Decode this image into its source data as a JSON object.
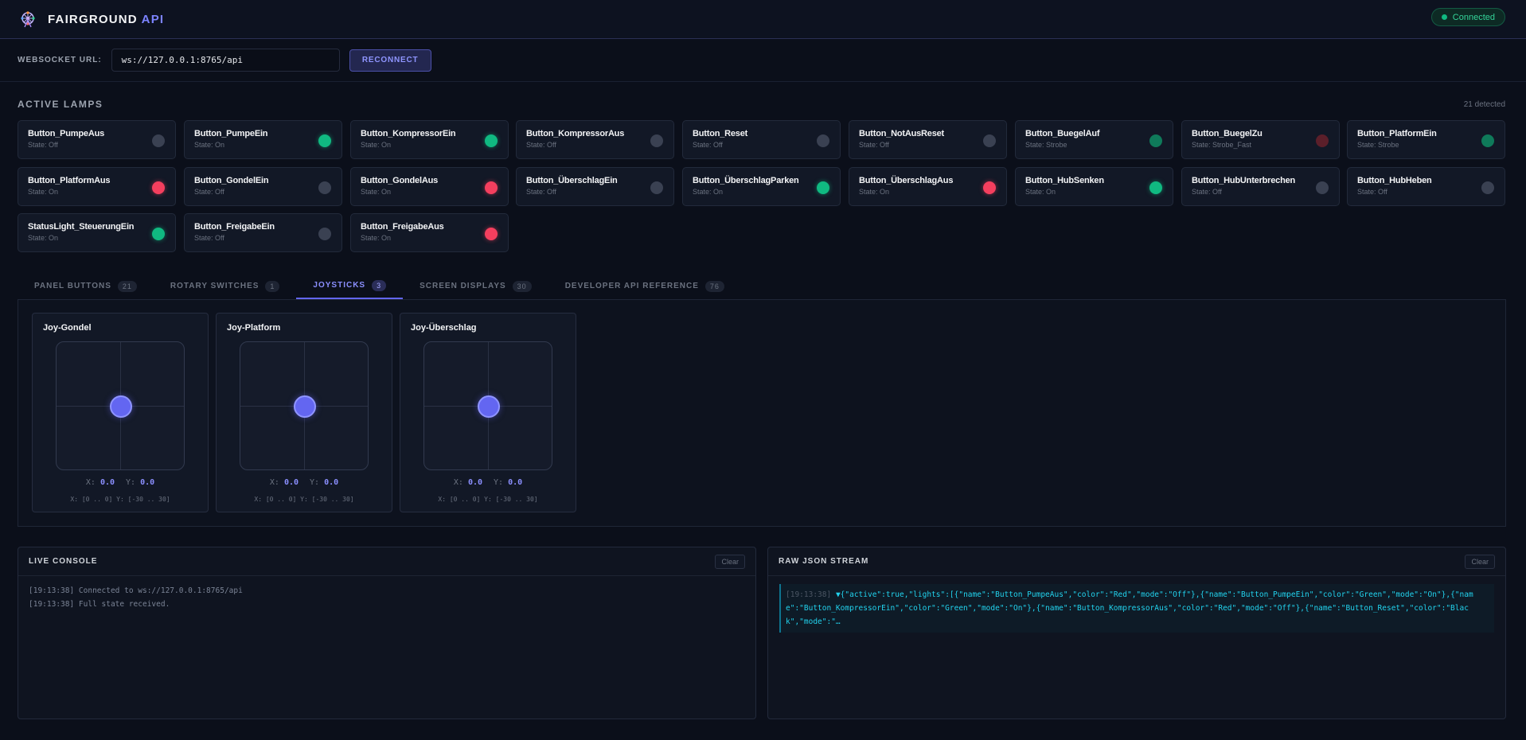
{
  "header": {
    "brand_main": "FAIRGROUND",
    "brand_accent": "API",
    "status": "Connected",
    "colors": {
      "accent": "#6366f1",
      "connected": "#10b981"
    }
  },
  "urlbar": {
    "label": "WEBSOCKET URL:",
    "value": "ws://127.0.0.1:8765/api",
    "reconnect_label": "RECONNECT"
  },
  "lamps": {
    "title": "ACTIVE LAMPS",
    "detected": "21 detected",
    "items": [
      {
        "name": "Button_PumpeAus",
        "state": "State: Off",
        "dot": "off"
      },
      {
        "name": "Button_PumpeEin",
        "state": "State: On",
        "dot": "green"
      },
      {
        "name": "Button_KompressorEin",
        "state": "State: On",
        "dot": "green"
      },
      {
        "name": "Button_KompressorAus",
        "state": "State: Off",
        "dot": "off"
      },
      {
        "name": "Button_Reset",
        "state": "State: Off",
        "dot": "off"
      },
      {
        "name": "Button_NotAusReset",
        "state": "State: Off",
        "dot": "off"
      },
      {
        "name": "Button_BuegelAuf",
        "state": "State: Strobe",
        "dot": "green-dim"
      },
      {
        "name": "Button_BuegelZu",
        "state": "State: Strobe_Fast",
        "dot": "red-dim"
      },
      {
        "name": "Button_PlatformEin",
        "state": "State: Strobe",
        "dot": "green-dim"
      },
      {
        "name": "Button_PlatformAus",
        "state": "State: On",
        "dot": "red"
      },
      {
        "name": "Button_GondelEin",
        "state": "State: Off",
        "dot": "off"
      },
      {
        "name": "Button_GondelAus",
        "state": "State: On",
        "dot": "red"
      },
      {
        "name": "Button_ÜberschlagEin",
        "state": "State: Off",
        "dot": "off"
      },
      {
        "name": "Button_ÜberschlagParken",
        "state": "State: On",
        "dot": "green"
      },
      {
        "name": "Button_ÜberschlagAus",
        "state": "State: On",
        "dot": "red"
      },
      {
        "name": "Button_HubSenken",
        "state": "State: On",
        "dot": "green"
      },
      {
        "name": "Button_HubUnterbrechen",
        "state": "State: Off",
        "dot": "off"
      },
      {
        "name": "Button_HubHeben",
        "state": "State: Off",
        "dot": "off"
      },
      {
        "name": "StatusLight_SteuerungEin",
        "state": "State: On",
        "dot": "green"
      },
      {
        "name": "Button_FreigabeEin",
        "state": "State: Off",
        "dot": "off"
      },
      {
        "name": "Button_FreigabeAus",
        "state": "State: On",
        "dot": "red"
      }
    ]
  },
  "tabs": [
    {
      "label": "PANEL BUTTONS",
      "count": "21"
    },
    {
      "label": "ROTARY SWITCHES",
      "count": "1"
    },
    {
      "label": "JOYSTICKS",
      "count": "3"
    },
    {
      "label": "SCREEN DISPLAYS",
      "count": "30"
    },
    {
      "label": "DEVELOPER API REFERENCE",
      "count": "76"
    }
  ],
  "joysticks": [
    {
      "title": "Joy-Gondel",
      "x_label": "X:",
      "x": "0.0",
      "y_label": "Y:",
      "y": "0.0",
      "range": "X: [0 .. 0] Y: [-30 .. 30]"
    },
    {
      "title": "Joy-Platform",
      "x_label": "X:",
      "x": "0.0",
      "y_label": "Y:",
      "y": "0.0",
      "range": "X: [0 .. 0] Y: [-30 .. 30]"
    },
    {
      "title": "Joy-Überschlag",
      "x_label": "X:",
      "x": "0.0",
      "y_label": "Y:",
      "y": "0.0",
      "range": "X: [0 .. 0] Y: [-30 .. 30]"
    }
  ],
  "console": {
    "title": "LIVE CONSOLE",
    "clear_label": "Clear",
    "lines": [
      "[19:13:38] Connected to ws://127.0.0.1:8765/api",
      "[19:13:38] Full state received."
    ]
  },
  "json_stream": {
    "title": "RAW JSON STREAM",
    "clear_label": "Clear",
    "timestamp": "[19:13:38]",
    "text": "▼{\"active\":true,\"lights\":[{\"name\":\"Button_PumpeAus\",\"color\":\"Red\",\"mode\":\"Off\"},{\"name\":\"Button_PumpeEin\",\"color\":\"Green\",\"mode\":\"On\"},{\"name\":\"Button_KompressorEin\",\"color\":\"Green\",\"mode\":\"On\"},{\"name\":\"Button_KompressorAus\",\"color\":\"Red\",\"mode\":\"Off\"},{\"name\":\"Button_Reset\",\"color\":\"Black\",\"mode\":\"…"
  }
}
